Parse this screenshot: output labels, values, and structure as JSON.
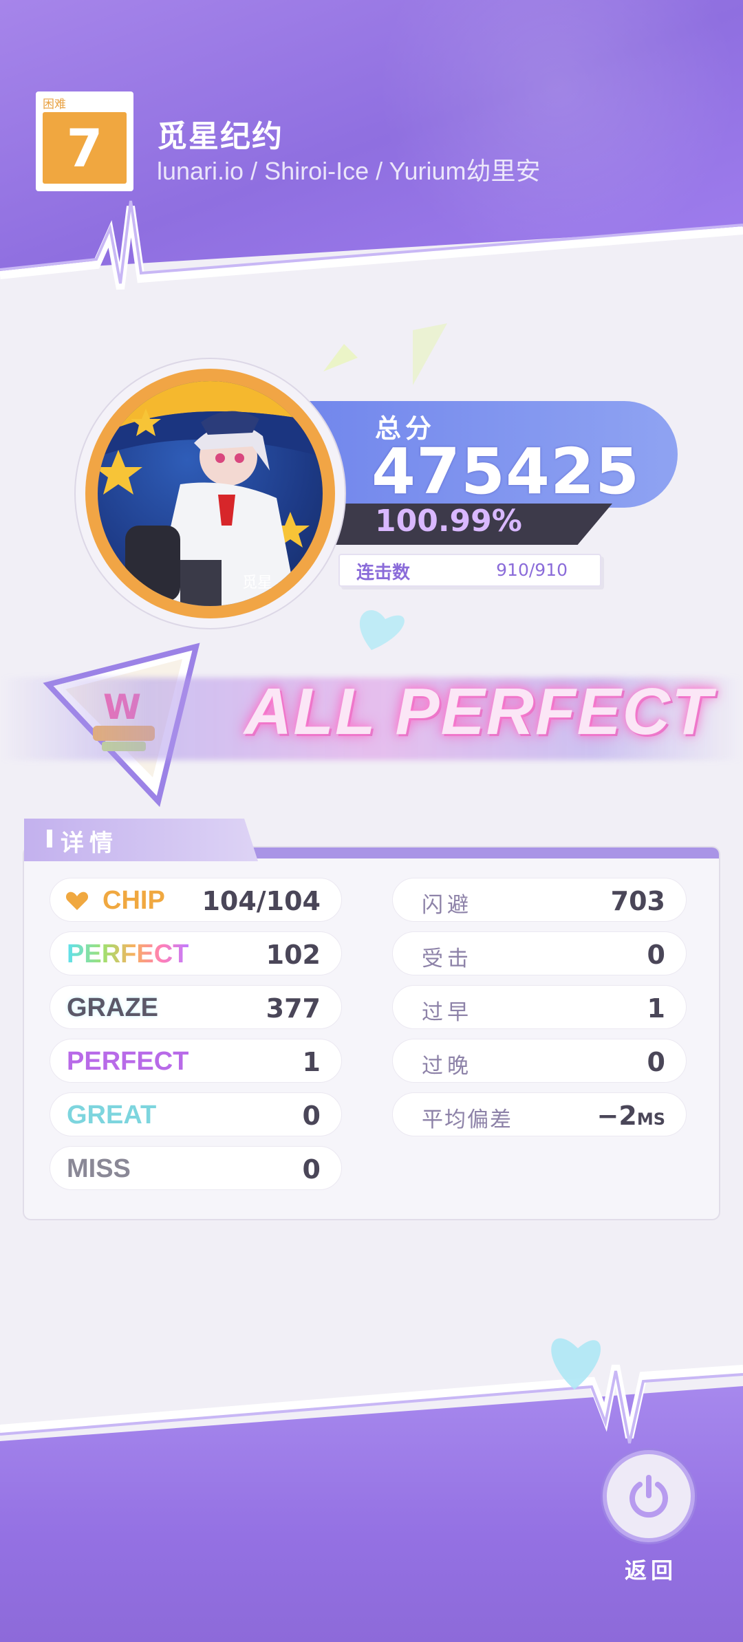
{
  "header": {
    "difficulty_label": "困难",
    "difficulty_level": "7",
    "song_title": "觅星纪约",
    "song_artists": "lunari.io / Shiroi-Ice / Yurium幼里安"
  },
  "score": {
    "label": "总分",
    "value": "475425",
    "accuracy": "100.99%",
    "combo_label": "连击数",
    "combo_value": "910/910"
  },
  "result": {
    "rank_text": "ALL PERFECT"
  },
  "details": {
    "title": "详情",
    "left_rows": [
      {
        "label": "CHIP",
        "value": "104/104"
      },
      {
        "label": "PERFECT",
        "value": "102"
      },
      {
        "label": "GRAZE",
        "value": "377"
      },
      {
        "label": "PERFECT",
        "value": "1"
      },
      {
        "label": "GREAT",
        "value": "0"
      },
      {
        "label": "MISS",
        "value": "0"
      }
    ],
    "right_rows": [
      {
        "label": "闪避",
        "value": "703"
      },
      {
        "label": "受击",
        "value": "0"
      },
      {
        "label": "过早",
        "value": "1"
      },
      {
        "label": "过晚",
        "value": "0"
      },
      {
        "label": "平均偏差",
        "value": "−2",
        "unit": "MS"
      }
    ]
  },
  "footer": {
    "back_label": "返回"
  },
  "colors": {
    "accent_purple": "#9a7be6",
    "difficulty_orange": "#f0a740",
    "score_blue": "#7a8eee"
  }
}
